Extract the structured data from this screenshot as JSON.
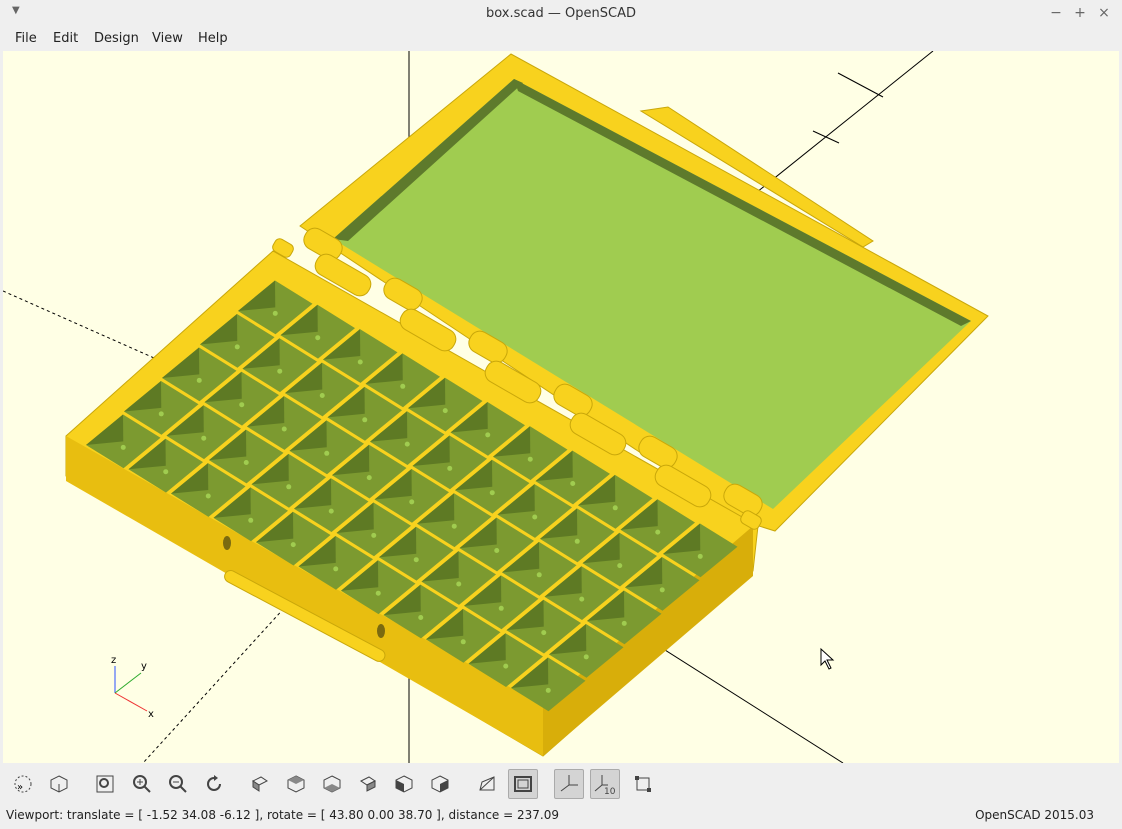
{
  "window": {
    "title": "box.scad — OpenSCAD"
  },
  "menu": {
    "file": "File",
    "edit": "Edit",
    "design": "Design",
    "view": "View",
    "help": "Help"
  },
  "axes": {
    "z": "z",
    "y": "y",
    "x": "x"
  },
  "toolbar": {
    "icons": [
      "preview-icon",
      "render-icon",
      "view-all-icon",
      "zoom-in-icon",
      "zoom-out-icon",
      "reset-view-icon",
      "view-right-icon",
      "view-top-icon",
      "view-bottom-icon",
      "view-left-icon",
      "view-front-icon",
      "view-back-icon",
      "perspective-icon",
      "orthogonal-icon",
      "show-axes-icon",
      "show-scale-markers-icon",
      "show-edges-icon"
    ],
    "scale_label": "10"
  },
  "status": {
    "viewport": "Viewport: translate = [ -1.52 34.08 -6.12 ], rotate = [ 43.80 0.00 38.70 ], distance = 237.09",
    "version": "OpenSCAD 2015.03"
  },
  "colors": {
    "model_yellow": "#f8d21e",
    "model_green": "#a0cc50",
    "background": "#ffffe5"
  }
}
